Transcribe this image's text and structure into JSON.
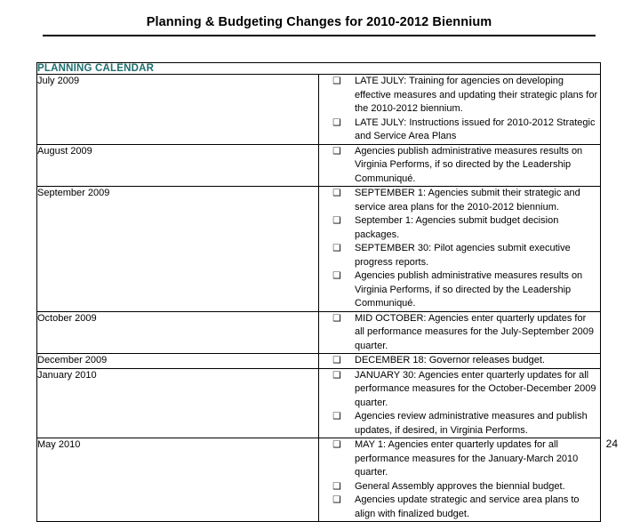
{
  "slide": {
    "title": "Planning & Budgeting Changes for 2010-2012 Biennium",
    "page_number": "24"
  },
  "colors": {
    "header_text": "#1f6e6e",
    "table_border": "#000000",
    "body_text": "#000000",
    "background": "#ffffff"
  },
  "table": {
    "header": "PLANNING CALENDAR",
    "checkbox_glyph": "❑",
    "checkbox_icon_name": "empty-checkbox-icon",
    "rows": [
      {
        "month": "July 2009",
        "items": [
          "LATE JULY:  Training for agencies on developing effective measures and updating their strategic plans for the 2010-2012 biennium.",
          "LATE JULY:  Instructions issued for 2010-2012 Strategic and Service Area Plans"
        ]
      },
      {
        "month": "August 2009",
        "items": [
          "Agencies publish administrative measures results on Virginia Performs, if so directed by the Leadership Communiqué."
        ]
      },
      {
        "month": "September 2009",
        "items": [
          "SEPTEMBER 1:  Agencies submit their strategic and service area plans for the 2010-2012 biennium.",
          "September 1:  Agencies submit budget decision packages.",
          "SEPTEMBER 30:  Pilot agencies submit executive progress reports.",
          "Agencies publish administrative measures results on Virginia Performs, if so directed by the Leadership Communiqué."
        ]
      },
      {
        "month": "October 2009",
        "items": [
          "MID OCTOBER:  Agencies enter quarterly updates for all performance measures for the July-September 2009 quarter."
        ]
      },
      {
        "month": "December 2009",
        "items": [
          "DECEMBER 18:  Governor releases budget."
        ]
      },
      {
        "month": "January 2010",
        "items": [
          "JANUARY 30:  Agencies enter quarterly updates for all performance measures for the October-December 2009 quarter.",
          "Agencies review administrative measures and publish updates, if desired, in Virginia Performs."
        ]
      },
      {
        "month": "May 2010",
        "items": [
          "MAY 1:  Agencies enter quarterly updates for all performance measures for the January-March 2010 quarter.",
          "General Assembly approves the biennial budget.",
          "Agencies update strategic and service area plans to align with finalized budget."
        ]
      }
    ]
  }
}
